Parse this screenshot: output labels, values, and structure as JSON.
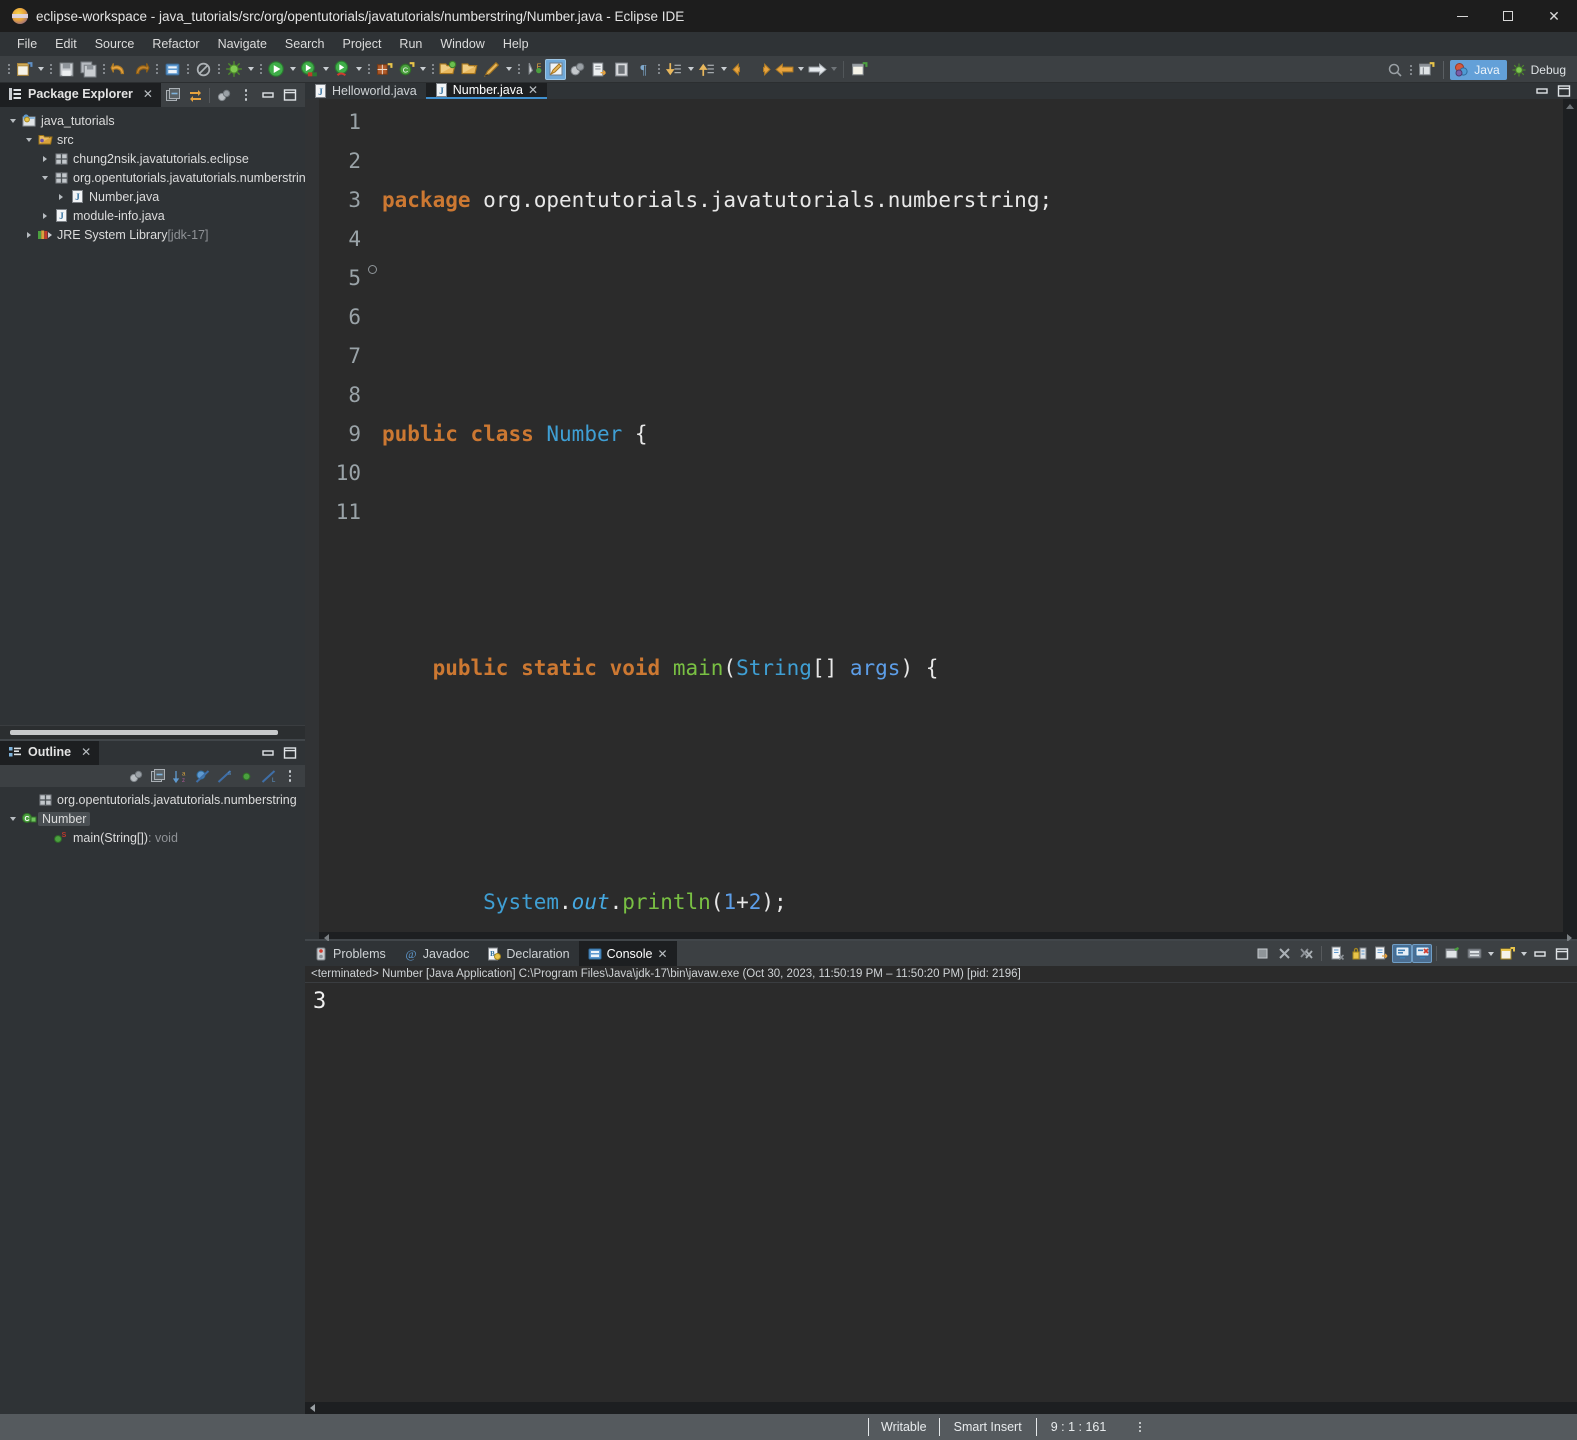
{
  "window": {
    "title": "eclipse-workspace - java_tutorials/src/org/opentutorials/javatutorials/numberstring/Number.java - Eclipse IDE",
    "logo_icon": "eclipse-logo-icon",
    "minimize_label": "—",
    "maximize_label": "",
    "close_label": "✕"
  },
  "menubar": {
    "items": [
      {
        "label": "File"
      },
      {
        "label": "Edit"
      },
      {
        "label": "Source"
      },
      {
        "label": "Refactor"
      },
      {
        "label": "Navigate"
      },
      {
        "label": "Search"
      },
      {
        "label": "Project"
      },
      {
        "label": "Run"
      },
      {
        "label": "Window"
      },
      {
        "label": "Help"
      }
    ]
  },
  "toolbar": {
    "icons": [
      "new-wizard-icon",
      "save-icon",
      "save-all-icon",
      "undo-icon",
      "redo-icon",
      "print-icon",
      "no-search-icon",
      "debug-icon",
      "run-icon",
      "run-coverage-icon",
      "run-external-icon",
      "new-package-icon",
      "new-class-icon",
      "open-type-icon",
      "open-task-icon",
      "pencil-icon",
      "toggle-mark-occurrences-icon",
      "skip-breakpoints-icon",
      "external-tools-icon",
      "search-icon",
      "show-whitespace-icon",
      "next-annotation-icon",
      "previous-annotation-icon",
      "back-icon",
      "forward-icon",
      "prev-edit-icon",
      "next-edit-icon",
      "new-java-project-icon"
    ],
    "search_icon": "quick-access-search-icon",
    "open-perspective-icon": "open-perspective-icon"
  },
  "perspectives": {
    "items": [
      {
        "label": "Java",
        "icon": "java-perspective-icon",
        "active": true
      },
      {
        "label": "Debug",
        "icon": "debug-perspective-icon",
        "active": false
      }
    ]
  },
  "package_explorer": {
    "tab_label": "Package Explorer",
    "tab_icon": "package-explorer-icon",
    "close_label": "✕",
    "tools": [
      "collapse-all-icon",
      "link-with-editor-icon",
      "view-menu-focus-icon",
      "view-menu-icon",
      "minimize-icon",
      "maximize-icon"
    ],
    "tree": [
      {
        "label": "java_tutorials",
        "indent": 0,
        "arrow": "open",
        "icon": "java-project-icon"
      },
      {
        "label": "src",
        "indent": 1,
        "arrow": "open",
        "icon": "source-folder-icon"
      },
      {
        "label": "chung2nsik.javatutorials.eclipse",
        "indent": 2,
        "arrow": "closed",
        "icon": "package-icon"
      },
      {
        "label": "org.opentutorials.javatutorials.numberstring",
        "indent": 2,
        "arrow": "open",
        "icon": "package-icon"
      },
      {
        "label": "Number.java",
        "indent": 3,
        "arrow": "closed",
        "icon": "java-file-icon"
      },
      {
        "label": "module-info.java",
        "indent": 2,
        "arrow": "closed",
        "icon": "java-file-icon"
      },
      {
        "label": "JRE System Library",
        "suffix": " [jdk-17]",
        "indent": 1,
        "arrow": "closed",
        "icon": "jre-library-icon"
      }
    ]
  },
  "outline": {
    "tab_label": "Outline",
    "tab_icon": "outline-icon",
    "close_label": "✕",
    "tools": [
      "focus-on-active-task-icon",
      "collapse-all-icon",
      "sort-icon",
      "hide-fields-icon",
      "hide-static-icon",
      "hide-nonpublic-icon",
      "hide-local-types-icon",
      "view-menu-icon"
    ],
    "tree": [
      {
        "label": "org.opentutorials.javatutorials.numberstring",
        "indent": 1,
        "arrow": "none",
        "icon": "package-icon"
      },
      {
        "label": "Number",
        "indent": 0,
        "arrow": "open",
        "icon": "class-icon",
        "selected": true
      },
      {
        "label": "main(String[])",
        "suffix": " : void",
        "indent": 2,
        "arrow": "none",
        "icon": "public-method-static-icon"
      }
    ]
  },
  "editor": {
    "tabs": [
      {
        "label": "Helloworld.java",
        "icon": "java-file-icon",
        "active": false,
        "closable": false
      },
      {
        "label": "Number.java",
        "icon": "java-file-icon",
        "active": true,
        "closable": true,
        "close_label": "✕"
      }
    ],
    "minimize_icon": "minimize-icon",
    "maximize_icon": "maximize-icon",
    "line_numbers": [
      "1",
      "2",
      "3",
      "4",
      "5",
      "6",
      "7",
      "8",
      "9",
      "10",
      "11"
    ],
    "current_line": 9,
    "lines": [
      {
        "n": 1,
        "tokens": [
          {
            "t": "package",
            "c": "kw"
          },
          {
            "t": " ",
            "c": "plain"
          },
          {
            "t": "org.opentutorials.javatutorials.numberstring;",
            "c": "plain"
          }
        ]
      },
      {
        "n": 2,
        "tokens": []
      },
      {
        "n": 3,
        "tokens": [
          {
            "t": "public",
            "c": "kw"
          },
          {
            "t": " ",
            "c": "plain"
          },
          {
            "t": "class",
            "c": "kw"
          },
          {
            "t": " ",
            "c": "plain"
          },
          {
            "t": "Number",
            "c": "cls"
          },
          {
            "t": " {",
            "c": "plain"
          }
        ]
      },
      {
        "n": 4,
        "tokens": []
      },
      {
        "n": 5,
        "tokens": [
          {
            "t": "    ",
            "c": "plain"
          },
          {
            "t": "public",
            "c": "kw"
          },
          {
            "t": " ",
            "c": "plain"
          },
          {
            "t": "static",
            "c": "kw"
          },
          {
            "t": " ",
            "c": "plain"
          },
          {
            "t": "void",
            "c": "kw"
          },
          {
            "t": " ",
            "c": "plain"
          },
          {
            "t": "main",
            "c": "meth"
          },
          {
            "t": "(",
            "c": "plain"
          },
          {
            "t": "String",
            "c": "cls"
          },
          {
            "t": "[] ",
            "c": "plain"
          },
          {
            "t": "args",
            "c": "num"
          },
          {
            "t": ") {",
            "c": "plain"
          }
        ],
        "marker": true
      },
      {
        "n": 6,
        "tokens": []
      },
      {
        "n": 7,
        "tokens": [
          {
            "t": "        ",
            "c": "plain"
          },
          {
            "t": "System",
            "c": "cls"
          },
          {
            "t": ".",
            "c": "plain"
          },
          {
            "t": "out",
            "c": "fld"
          },
          {
            "t": ".",
            "c": "plain"
          },
          {
            "t": "println",
            "c": "meth"
          },
          {
            "t": "(",
            "c": "plain"
          },
          {
            "t": "1",
            "c": "num"
          },
          {
            "t": "+",
            "c": "plain"
          },
          {
            "t": "2",
            "c": "num"
          },
          {
            "t": ");",
            "c": "plain"
          }
        ]
      },
      {
        "n": 8,
        "tokens": [
          {
            "t": "    }",
            "c": "plain"
          }
        ]
      },
      {
        "n": 9,
        "tokens": []
      },
      {
        "n": 10,
        "tokens": [
          {
            "t": "}",
            "c": "plain"
          }
        ]
      },
      {
        "n": 11,
        "tokens": []
      }
    ]
  },
  "console_panel": {
    "tabs": [
      {
        "label": "Problems",
        "icon": "problems-icon",
        "active": false
      },
      {
        "label": "Javadoc",
        "icon": "javadoc-icon",
        "active": false
      },
      {
        "label": "Declaration",
        "icon": "declaration-icon",
        "active": false
      },
      {
        "label": "Console",
        "icon": "console-icon",
        "active": true,
        "close_label": "✕"
      }
    ],
    "tools": [
      "terminate-icon",
      "remove-launch-icon",
      "remove-all-terminated-icon",
      "clear-console-icon",
      "scroll-lock-icon",
      "word-wrap-icon",
      "show-console-on-output-icon",
      "show-console-on-error-icon",
      "pin-console-icon",
      "display-selected-console-icon",
      "open-console-icon",
      "minimize-icon",
      "maximize-icon"
    ],
    "status_line": "<terminated> Number [Java Application] C:\\Program Files\\Java\\jdk-17\\bin\\javaw.exe  (Oct 30, 2023, 11:50:19 PM – 11:50:20 PM) [pid: 2196]",
    "output": "3"
  },
  "statusbar": {
    "writable": "Writable",
    "insert_mode": "Smart Insert",
    "position": "9 : 1 : 161",
    "menu_icon": "status-menu-icon"
  },
  "colors": {
    "keyword": "#cc7832",
    "class": "#3f9fd4",
    "method": "#79c043",
    "field": "#45a8e0",
    "number": "#5d9ee8",
    "editor_bg": "#2b2b2b",
    "panel_bg": "#2f3336",
    "toolbar_bg": "#3c4043",
    "accent": "#3f8fce",
    "statusbar_bg": "#555a5e"
  }
}
